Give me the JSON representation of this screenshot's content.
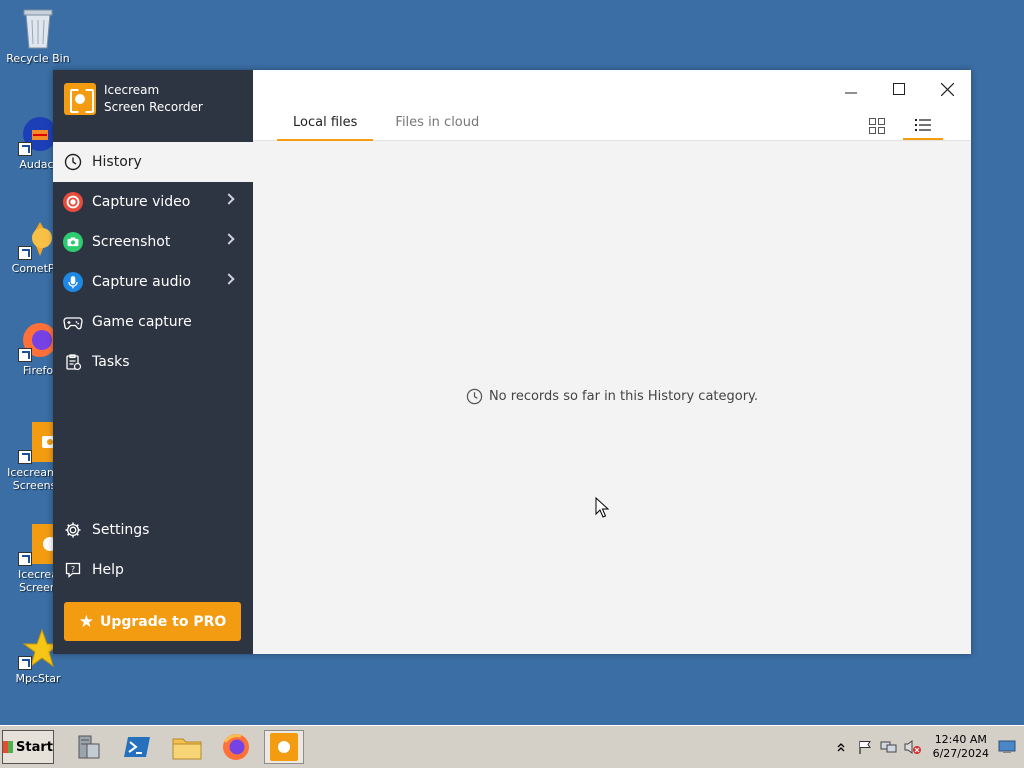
{
  "desktop": {
    "icons": [
      {
        "label": "Recycle Bin",
        "icon": "recycle-bin-icon"
      },
      {
        "label": "Audaci",
        "icon": "audacity-icon"
      },
      {
        "label": "CometPla",
        "icon": "cometplayer-icon"
      },
      {
        "label": "Firefo",
        "icon": "firefox-icon"
      },
      {
        "label": "Icecream C Screensh",
        "icon": "icecream-screenshot-icon"
      },
      {
        "label": "Icecrea Screen",
        "icon": "icecream-screen-recorder-icon"
      },
      {
        "label": "MpcStar",
        "icon": "mpcstar-icon"
      }
    ]
  },
  "app": {
    "brand_line1": "Icecream",
    "brand_line2": "Screen Recorder",
    "nav": [
      {
        "label": "History",
        "icon": "clock-icon",
        "active": true
      },
      {
        "label": "Capture video",
        "icon": "record-icon",
        "has_submenu": true,
        "color": "#e74c3c"
      },
      {
        "label": "Screenshot",
        "icon": "camera-icon",
        "has_submenu": true,
        "color": "#2ecc71"
      },
      {
        "label": "Capture audio",
        "icon": "microphone-icon",
        "has_submenu": true,
        "color": "#1e88e5"
      },
      {
        "label": "Game capture",
        "icon": "gamepad-icon"
      },
      {
        "label": "Tasks",
        "icon": "tasks-icon"
      }
    ],
    "bottom_nav": [
      {
        "label": "Settings",
        "icon": "gear-icon"
      },
      {
        "label": "Help",
        "icon": "help-icon"
      }
    ],
    "upgrade_label": "Upgrade to PRO",
    "tabs": [
      {
        "label": "Local files",
        "active": true
      },
      {
        "label": "Files in cloud",
        "active": false
      }
    ],
    "view_modes": [
      {
        "icon": "grid-view-icon",
        "active": false
      },
      {
        "icon": "list-view-icon",
        "active": true
      }
    ],
    "empty_message": "No records so far in this History category.",
    "accent_color": "#f39c12",
    "sidebar_color": "#2e3542"
  },
  "taskbar": {
    "start_label": "Start",
    "apps": [
      "server-manager-icon",
      "powershell-icon",
      "explorer-icon",
      "firefox-icon",
      "icecream-screen-recorder-icon"
    ],
    "clock_time": "12:40 AM",
    "clock_date": "6/27/2024"
  }
}
